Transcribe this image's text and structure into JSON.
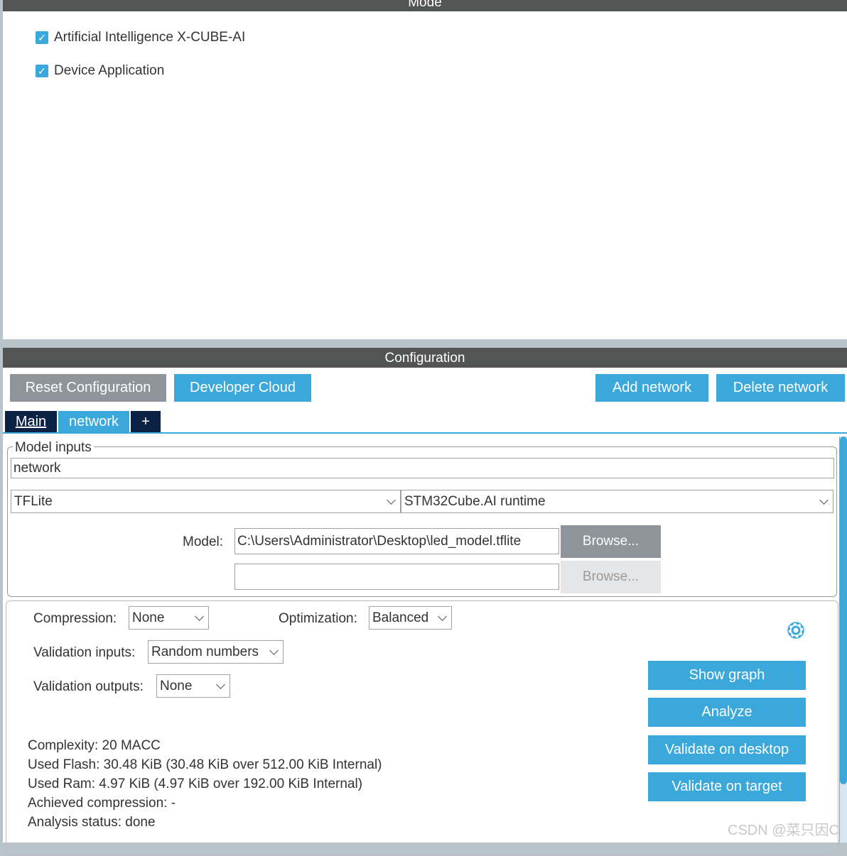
{
  "mode": {
    "title": "Mode",
    "checkboxes": [
      {
        "label": "Artificial Intelligence X-CUBE-AI",
        "checked": true
      },
      {
        "label": "Device Application",
        "checked": true
      }
    ]
  },
  "config": {
    "title": "Configuration",
    "buttons": {
      "reset": "Reset Configuration",
      "cloud": "Developer Cloud",
      "add": "Add network",
      "delete": "Delete network"
    },
    "tabs": [
      {
        "label": "Main"
      },
      {
        "label": "network",
        "active": true
      },
      {
        "label": "+"
      }
    ],
    "model_inputs": {
      "legend": "Model inputs",
      "name": "network",
      "framework": "TFLite",
      "runtime": "STM32Cube.AI runtime",
      "model_label": "Model:",
      "model_path": "C:\\Users\\Administrator\\Desktop\\led_model.tflite",
      "browse": "Browse...",
      "browse2": "Browse...",
      "path2": ""
    },
    "settings": {
      "compression_label": "Compression:",
      "compression": "None",
      "optimization_label": "Optimization:",
      "optimization": "Balanced",
      "val_inputs_label": "Validation inputs:",
      "val_inputs": "Random numbers",
      "val_outputs_label": "Validation outputs:",
      "val_outputs": "None"
    },
    "actions": {
      "show_graph": "Show graph",
      "analyze": "Analyze",
      "validate_desktop": "Validate on desktop",
      "validate_target": "Validate on target"
    },
    "info": [
      "Complexity:  20 MACC",
      "Used Flash: 30.48 KiB (30.48 KiB over 512.00 KiB Internal)",
      "Used Ram: 4.97 KiB (4.97 KiB over 192.00 KiB Internal)",
      "Achieved compression: -",
      "Analysis status: done"
    ]
  },
  "watermark": "CSDN @菜只因C"
}
